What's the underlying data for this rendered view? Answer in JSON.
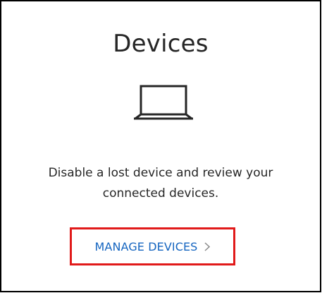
{
  "card": {
    "title": "Devices",
    "icon": "laptop-icon",
    "description": "Disable a lost device and review your connected devices.",
    "action": {
      "label": "MANAGE DEVICES",
      "icon": "chevron-right-icon"
    }
  },
  "colors": {
    "link": "#1565c0",
    "highlight_box": "#e11a1a",
    "text": "#262626"
  }
}
